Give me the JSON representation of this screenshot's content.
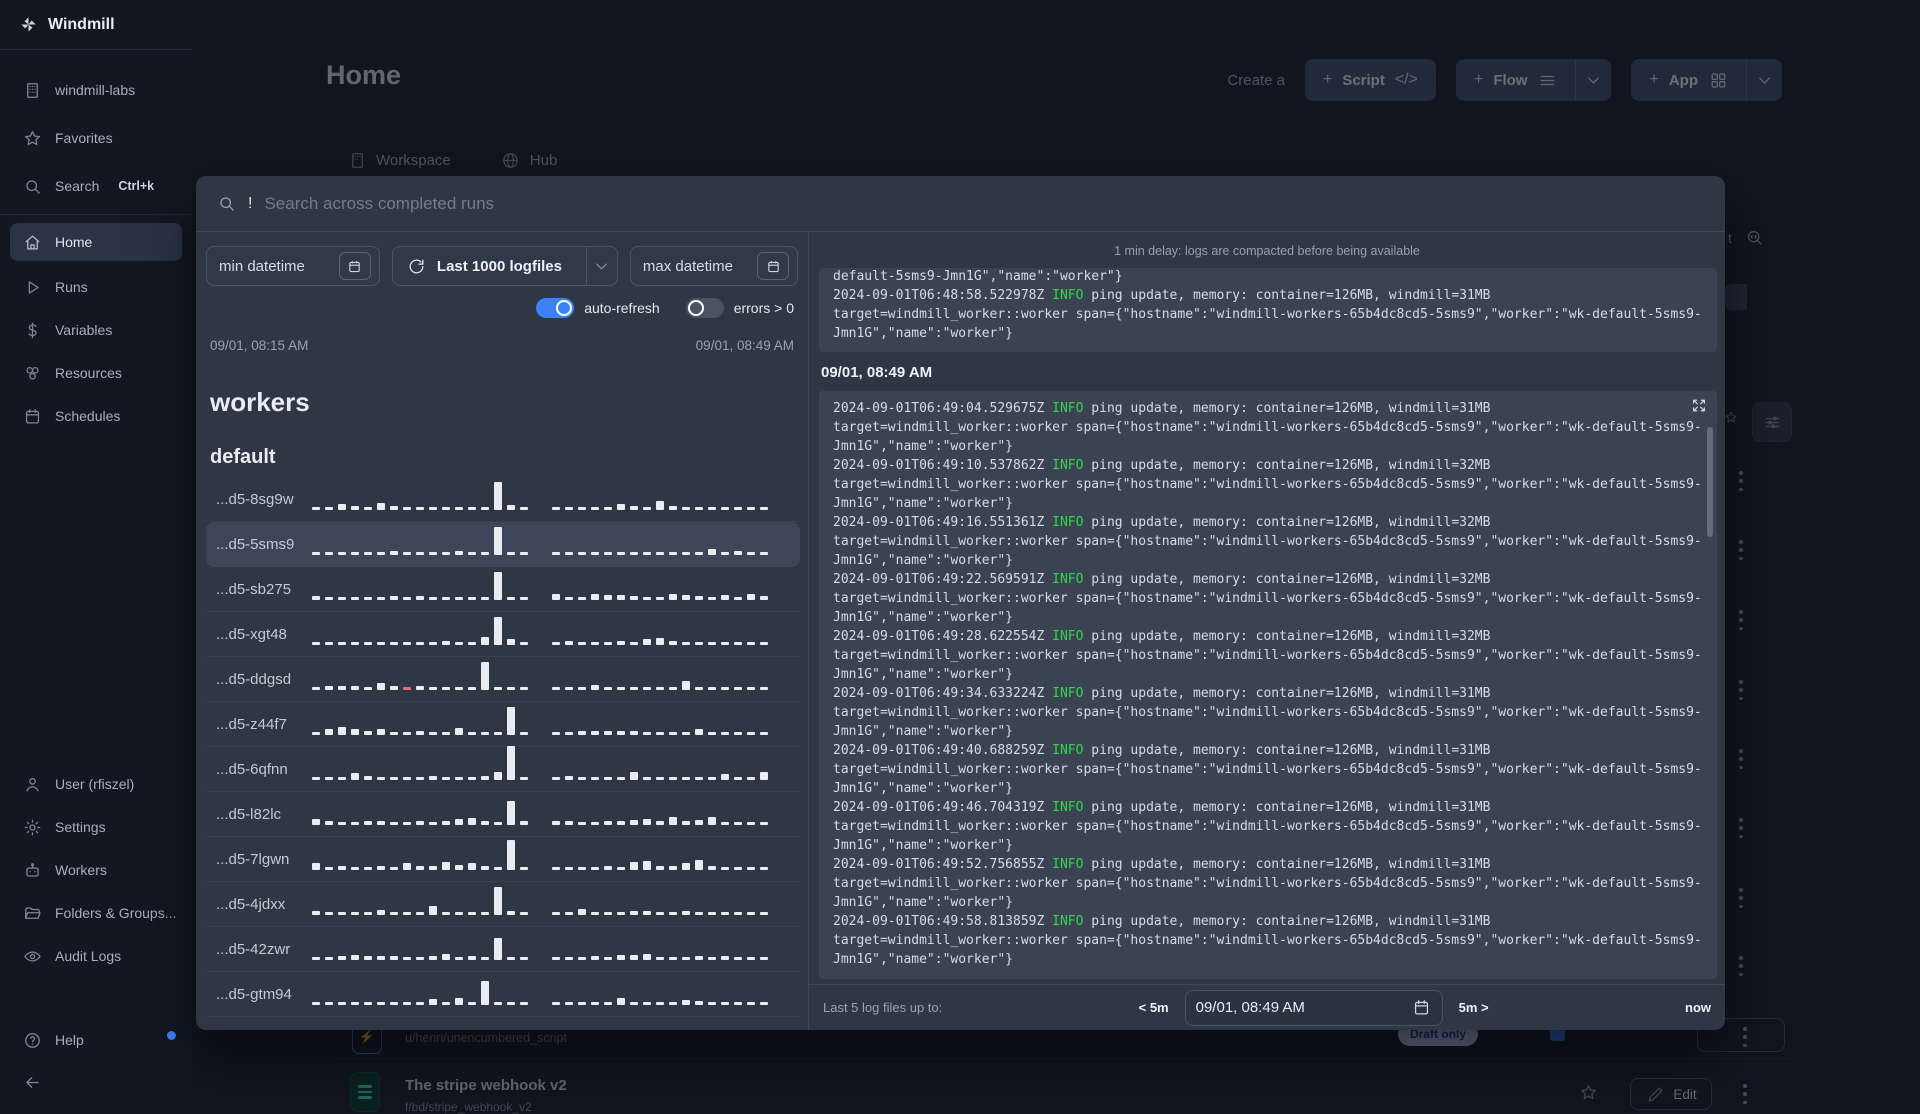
{
  "app": {
    "title": "Windmill"
  },
  "sidebar": {
    "workspace": {
      "label": "windmill-labs"
    },
    "favorites": {
      "label": "Favorites"
    },
    "search": {
      "label": "Search",
      "shortcut": "Ctrl+k"
    },
    "nav": [
      {
        "label": "Home"
      },
      {
        "label": "Runs"
      },
      {
        "label": "Variables"
      },
      {
        "label": "Resources"
      },
      {
        "label": "Schedules"
      }
    ],
    "bottom": [
      {
        "label": "User (rfiszel)"
      },
      {
        "label": "Settings"
      },
      {
        "label": "Workers"
      },
      {
        "label": "Folders & Groups..."
      },
      {
        "label": "Audit Logs"
      }
    ],
    "help": {
      "label": "Help"
    }
  },
  "header": {
    "title": "Home",
    "create_prefix": "Create a",
    "script_label": "Script",
    "flow_label": "Flow",
    "app_label": "App"
  },
  "tabs": {
    "workspace": "Workspace",
    "hub": "Hub"
  },
  "background": {
    "row1": {
      "path": "u/henri/unencumbered_script",
      "badge": "Draft only"
    },
    "row2": {
      "title": "The stripe webhook v2",
      "path": "f/bd/stripe_webhook_v2",
      "edit_label": "Edit"
    },
    "trailing_text": "t"
  },
  "modal": {
    "search": {
      "prefix": "!",
      "placeholder": "Search across completed runs"
    },
    "filters": {
      "min_placeholder": "min datetime",
      "logfiles_label": "Last 1000 logfiles",
      "max_placeholder": "max datetime",
      "auto_refresh_label": "auto-refresh",
      "errors_label": "errors > 0"
    },
    "range_start": "09/01, 08:15 AM",
    "range_end": "09/01, 08:49 AM",
    "workers_heading": "workers",
    "group_heading": "default",
    "workers": [
      {
        "id": "...d5-8sg9w",
        "bars1": [
          3,
          3,
          6,
          4,
          3,
          7,
          4,
          3,
          3,
          3,
          3,
          3,
          3,
          3,
          28,
          5,
          3
        ],
        "bars2": [
          3,
          3,
          3,
          3,
          3,
          6,
          4,
          3,
          9,
          4,
          3,
          3,
          3,
          3,
          3,
          3,
          3
        ],
        "red1": []
      },
      {
        "id": "...d5-5sms9",
        "bars1": [
          3,
          3,
          3,
          3,
          3,
          3,
          4,
          3,
          3,
          3,
          3,
          4,
          3,
          3,
          28,
          3,
          3
        ],
        "bars2": [
          3,
          3,
          3,
          3,
          3,
          3,
          3,
          3,
          3,
          3,
          3,
          3,
          6,
          3,
          4,
          3,
          3
        ],
        "red1": []
      },
      {
        "id": "...d5-sb275",
        "bars1": [
          4,
          3,
          3,
          3,
          3,
          3,
          4,
          3,
          4,
          3,
          3,
          3,
          3,
          3,
          28,
          3,
          3
        ],
        "bars2": [
          6,
          3,
          3,
          6,
          5,
          5,
          4,
          3,
          3,
          6,
          5,
          4,
          3,
          5,
          3,
          6,
          4
        ],
        "red1": []
      },
      {
        "id": "...d5-xgt48",
        "bars1": [
          3,
          3,
          3,
          3,
          3,
          3,
          3,
          3,
          3,
          3,
          4,
          3,
          3,
          8,
          28,
          6,
          3
        ],
        "bars2": [
          3,
          4,
          3,
          3,
          3,
          4,
          3,
          6,
          7,
          4,
          3,
          3,
          3,
          3,
          3,
          3,
          3
        ],
        "red1": []
      },
      {
        "id": "...d5-ddgsd",
        "bars1": [
          3,
          4,
          4,
          4,
          3,
          7,
          4,
          3,
          4,
          3,
          3,
          3,
          3,
          28,
          3,
          3,
          3
        ],
        "bars2": [
          3,
          3,
          3,
          5,
          3,
          3,
          3,
          3,
          3,
          3,
          9,
          3,
          3,
          3,
          3,
          3,
          3
        ],
        "red1": [
          7
        ]
      },
      {
        "id": "...d5-z44f7",
        "bars1": [
          3,
          6,
          8,
          6,
          4,
          6,
          3,
          3,
          4,
          3,
          3,
          7,
          3,
          3,
          3,
          28,
          3
        ],
        "bars2": [
          3,
          3,
          4,
          4,
          4,
          4,
          4,
          3,
          3,
          3,
          3,
          6,
          3,
          3,
          3,
          3,
          3
        ],
        "red1": []
      },
      {
        "id": "...d5-6qfnn",
        "bars1": [
          3,
          3,
          3,
          7,
          4,
          3,
          3,
          3,
          3,
          4,
          3,
          3,
          3,
          4,
          8,
          34,
          3
        ],
        "bars2": [
          3,
          4,
          3,
          3,
          3,
          3,
          8,
          3,
          3,
          3,
          3,
          3,
          3,
          6,
          3,
          3,
          8
        ],
        "red1": []
      },
      {
        "id": "...d5-l82lc",
        "bars1": [
          6,
          4,
          3,
          3,
          4,
          4,
          3,
          3,
          4,
          3,
          4,
          6,
          7,
          4,
          3,
          24,
          4
        ],
        "bars2": [
          4,
          4,
          3,
          3,
          4,
          4,
          5,
          6,
          4,
          8,
          4,
          5,
          8,
          3,
          3,
          3,
          3
        ],
        "red1": []
      },
      {
        "id": "...d5-7lgwn",
        "bars1": [
          7,
          3,
          4,
          3,
          3,
          4,
          3,
          7,
          4,
          4,
          8,
          5,
          7,
          4,
          3,
          30,
          3
        ],
        "bars2": [
          3,
          3,
          3,
          3,
          4,
          3,
          8,
          9,
          4,
          4,
          7,
          10,
          4,
          3,
          3,
          3,
          3
        ],
        "red1": []
      },
      {
        "id": "...d5-4jdxx",
        "bars1": [
          4,
          3,
          3,
          3,
          3,
          5,
          3,
          3,
          3,
          9,
          3,
          3,
          3,
          3,
          28,
          4,
          3
        ],
        "bars2": [
          3,
          3,
          6,
          3,
          3,
          3,
          4,
          4,
          3,
          3,
          4,
          3,
          3,
          3,
          3,
          3,
          3
        ],
        "red1": []
      },
      {
        "id": "...d5-42zwr",
        "bars1": [
          3,
          3,
          4,
          5,
          4,
          4,
          4,
          3,
          3,
          4,
          6,
          3,
          4,
          3,
          22,
          3,
          3
        ],
        "bars2": [
          3,
          3,
          3,
          4,
          3,
          5,
          5,
          6,
          3,
          3,
          3,
          4,
          3,
          4,
          3,
          3,
          3
        ],
        "red1": []
      },
      {
        "id": "...d5-gtm94",
        "bars1": [
          3,
          3,
          3,
          3,
          3,
          3,
          3,
          3,
          3,
          6,
          3,
          7,
          3,
          24,
          3,
          3,
          3
        ],
        "bars2": [
          3,
          3,
          3,
          3,
          3,
          7,
          3,
          3,
          3,
          3,
          5,
          4,
          3,
          3,
          3,
          3,
          3
        ],
        "red1": []
      }
    ],
    "logs": {
      "notice": "1 min delay: logs are compacted before being available",
      "clipped_line": "default-5sms9-Jmn1G\",\"name\":\"worker\"}",
      "info_label": "INFO",
      "mid": " ping update, memory: container=126MB, windmill=",
      "span_line": "target=windmill_worker::worker span={\"hostname\":\"windmill-workers-65b4dc8cd5-5sms9\",\"worker\":\"wk-default-5sms9-Jmn1G\",\"name\":\"worker\"}",
      "prev_entries": [
        {
          "ts": "2024-09-01T06:48:58.522978Z",
          "mem": "31MB"
        }
      ],
      "date_header": "09/01, 08:49 AM",
      "entries": [
        {
          "ts": "2024-09-01T06:49:04.529675Z",
          "mem": "31MB"
        },
        {
          "ts": "2024-09-01T06:49:10.537862Z",
          "mem": "32MB"
        },
        {
          "ts": "2024-09-01T06:49:16.551361Z",
          "mem": "32MB"
        },
        {
          "ts": "2024-09-01T06:49:22.569591Z",
          "mem": "32MB"
        },
        {
          "ts": "2024-09-01T06:49:28.622554Z",
          "mem": "32MB"
        },
        {
          "ts": "2024-09-01T06:49:34.633224Z",
          "mem": "31MB"
        },
        {
          "ts": "2024-09-01T06:49:40.688259Z",
          "mem": "31MB"
        },
        {
          "ts": "2024-09-01T06:49:46.704319Z",
          "mem": "31MB"
        },
        {
          "ts": "2024-09-01T06:49:52.756855Z",
          "mem": "31MB"
        },
        {
          "ts": "2024-09-01T06:49:58.813859Z",
          "mem": "31MB"
        }
      ],
      "footer": {
        "label": "Last 5 log files up to:",
        "back": "< 5m",
        "value": "09/01, 08:49 AM",
        "fwd": "5m >",
        "now": "now"
      }
    }
  },
  "colors": {
    "accent": "#3b82f6",
    "info_green": "#32d74b",
    "error_bar": "#ef6a6a"
  }
}
